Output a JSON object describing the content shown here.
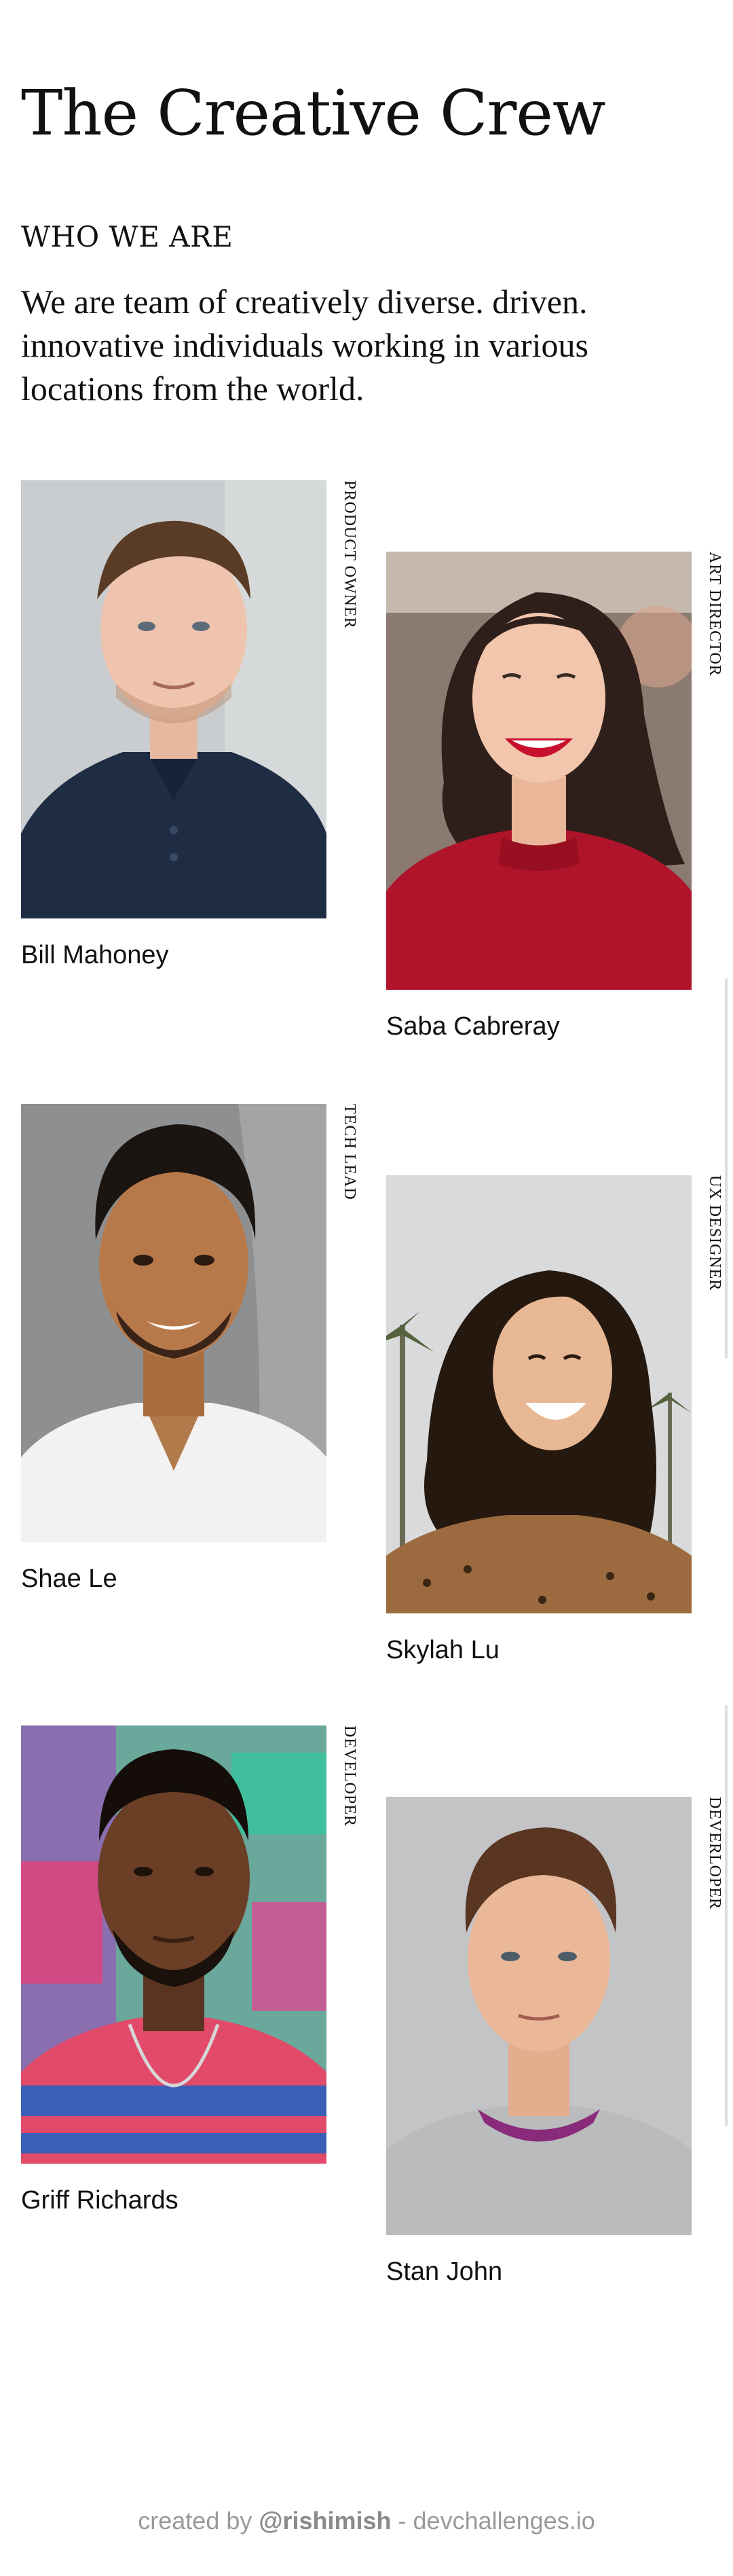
{
  "header": {
    "title": "The Creative Crew",
    "subtitle": "WHO WE ARE",
    "intro": "We are team of creatively diverse. driven. innovative individuals working in various locations from the world."
  },
  "members": [
    {
      "name": "Bill Mahoney",
      "role": "PRODUCT OWNER"
    },
    {
      "name": "Saba Cabreray",
      "role": "ART DIRECTOR"
    },
    {
      "name": "Shae Le",
      "role": "TECH LEAD"
    },
    {
      "name": "Skylah Lu",
      "role": "UX DESIGNER"
    },
    {
      "name": "Griff Richards",
      "role": "DEVELOPER"
    },
    {
      "name": "Stan John",
      "role": "DEVERLOPER"
    }
  ],
  "footer": {
    "prefix": "created by ",
    "handle": "@rishimish",
    "suffix": " - devchallenges.io"
  },
  "colors": {
    "background": "#ffffff",
    "text": "#111111",
    "footer_text": "#9a9a9a"
  }
}
